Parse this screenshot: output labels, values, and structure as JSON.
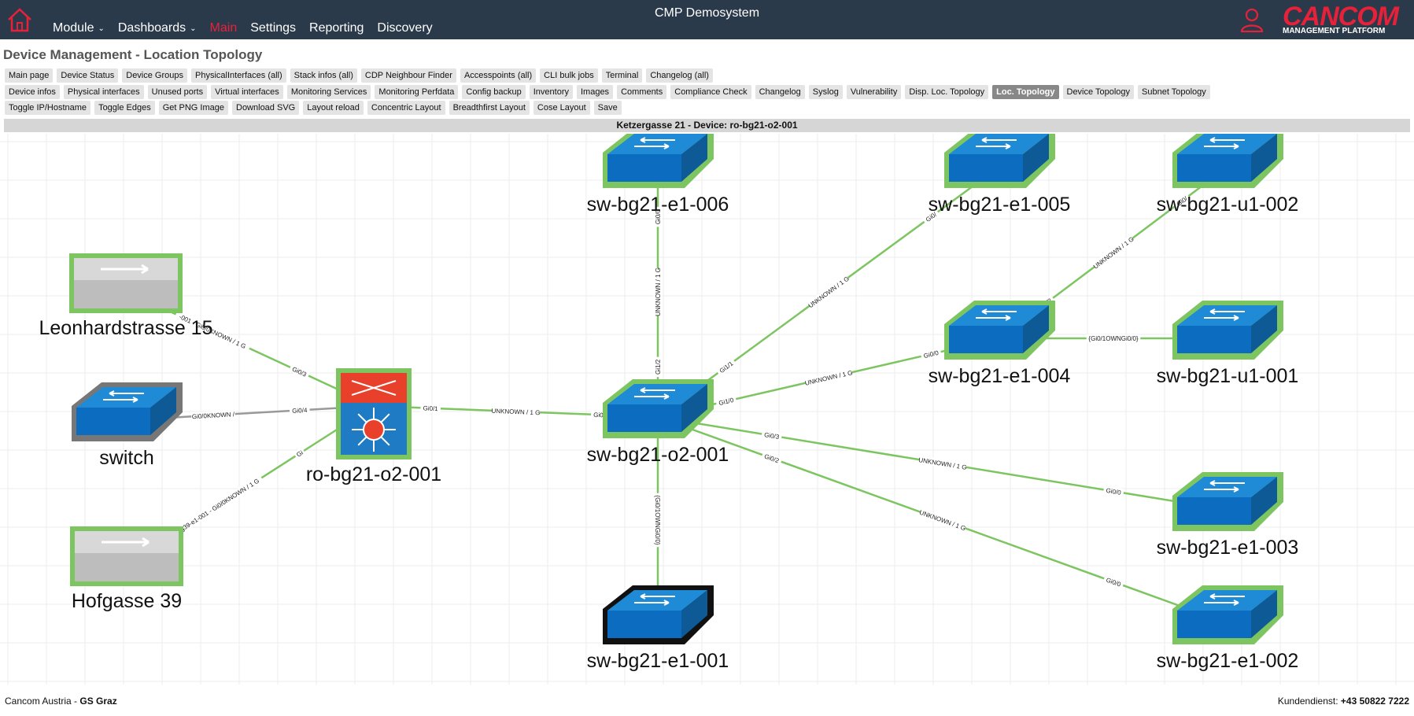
{
  "header": {
    "system_name": "CMP Demosystem",
    "nav": [
      {
        "label": "Module",
        "dropdown": true,
        "color": "#e8213a"
      },
      {
        "label": "Dashboards",
        "dropdown": true,
        "color": "#ffffff"
      },
      {
        "label": "Main",
        "dropdown": false,
        "color": "#e8213a"
      },
      {
        "label": "Settings",
        "dropdown": false,
        "color": "#ffffff"
      },
      {
        "label": "Reporting",
        "dropdown": false,
        "color": "#ffffff"
      },
      {
        "label": "Discovery",
        "dropdown": false,
        "color": "#ffffff"
      }
    ],
    "brand": "CANCOM",
    "brand_sub": "MANAGEMENT PLATFORM",
    "brand_color": "#e8213a",
    "bar_color": "#2b3a4a"
  },
  "page_title": "Device Management - Location Topology",
  "toolbar_rows": [
    [
      "Main page",
      "Device Status",
      "Device Groups",
      "PhysicalInterfaces (all)",
      "Stack infos (all)",
      "CDP Neighbour Finder",
      "Accesspoints (all)",
      "CLI bulk jobs",
      "Terminal",
      "Changelog (all)"
    ],
    [
      "Device infos",
      "Physical interfaces",
      "Unused ports",
      "Virtual interfaces",
      "Monitoring Services",
      "Monitoring Perfdata",
      "Config backup",
      "Inventory",
      "Images",
      "Comments",
      "Compliance Check",
      "Changelog",
      "Syslog",
      "Vulnerability",
      "Disp. Loc. Topology",
      "Loc. Topology",
      "Device Topology",
      "Subnet Topology"
    ],
    [
      "Toggle IP/Hostname",
      "Toggle Edges",
      "Get PNG Image",
      "Download SVG",
      "Layout reload",
      "Concentric Layout",
      "Breadthfirst Layout",
      "Cose Layout",
      "Save"
    ]
  ],
  "active_tab": "Loc. Topology",
  "device_header": "Ketzergasse 21 - Device: ro-bg21-o2-001",
  "topology": {
    "nodes": [
      {
        "id": "leon",
        "label": "Leonhardstrasse 15",
        "kind": "location",
        "border": "#7dc561"
      },
      {
        "id": "hof",
        "label": "Hofgasse 39",
        "kind": "location",
        "border": "#7dc561"
      },
      {
        "id": "switch",
        "label": "switch",
        "kind": "switch",
        "border": "#777777",
        "muted": true
      },
      {
        "id": "ro",
        "label": "ro-bg21-o2-001",
        "kind": "router",
        "border": "#7dc561",
        "selected": true
      },
      {
        "id": "o2",
        "label": "sw-bg21-o2-001",
        "kind": "switch",
        "border": "#7dc561"
      },
      {
        "id": "e6",
        "label": "sw-bg21-e1-006",
        "kind": "switch",
        "border": "#7dc561"
      },
      {
        "id": "e5",
        "label": "sw-bg21-e1-005",
        "kind": "switch",
        "border": "#7dc561"
      },
      {
        "id": "u2",
        "label": "sw-bg21-u1-002",
        "kind": "switch",
        "border": "#7dc561"
      },
      {
        "id": "e4",
        "label": "sw-bg21-e1-004",
        "kind": "switch",
        "border": "#7dc561"
      },
      {
        "id": "u1",
        "label": "sw-bg21-u1-001",
        "kind": "switch",
        "border": "#7dc561"
      },
      {
        "id": "e3",
        "label": "sw-bg21-e1-003",
        "kind": "switch",
        "border": "#7dc561"
      },
      {
        "id": "e2",
        "label": "sw-bg21-e1-002",
        "kind": "switch",
        "border": "#7dc561"
      },
      {
        "id": "e1",
        "label": "sw-bg21-e1-001",
        "kind": "switch",
        "border": "#111111"
      }
    ],
    "edges": [
      {
        "from": "leon",
        "to": "ro",
        "color": "#7dc561",
        "labels": [
          "-001 - Gi0/0KNOWN / 1 G",
          "Gi0/3"
        ]
      },
      {
        "from": "switch",
        "to": "ro",
        "color": "#999999",
        "labels": [
          "Gi0/0KNOWN /",
          "Gi0/4"
        ]
      },
      {
        "from": "hof",
        "to": "ro",
        "color": "#7dc561",
        "labels": [
          "sw-mg39-e1-001 - Gi0/0KNOWN / 1 G",
          "Gi"
        ]
      },
      {
        "from": "ro",
        "to": "o2",
        "color": "#7dc561",
        "labels": [
          "Gi0/1",
          "UNKNOWN / 1 G",
          "Gi0/0"
        ]
      },
      {
        "from": "o2",
        "to": "e6",
        "color": "#7dc561",
        "labels": [
          "Gi1/2",
          "UNKNOWN / 1 G",
          "Gi0/0"
        ]
      },
      {
        "from": "o2",
        "to": "e5",
        "color": "#7dc561",
        "labels": [
          "Gi1/1",
          "UNKNOWN / 1 G",
          "Gi0/"
        ]
      },
      {
        "from": "o2",
        "to": "e4",
        "color": "#7dc561",
        "labels": [
          "Gi1/0",
          "UNKNOWN / 1 G",
          "Gi0/0"
        ]
      },
      {
        "from": "e4",
        "to": "u2",
        "color": "#7dc561",
        "labels": [
          "Gi0/2",
          "UNKNOWN / 1 G",
          "Gi0/"
        ]
      },
      {
        "from": "e4",
        "to": "u1",
        "color": "#7dc561",
        "labels": [
          "{Gi0/1OWNGi0/0}"
        ]
      },
      {
        "from": "o2",
        "to": "e3",
        "color": "#7dc561",
        "labels": [
          "Gi0/3",
          "UNKNOWN / 1 G",
          "Gi0/0"
        ]
      },
      {
        "from": "o2",
        "to": "e2",
        "color": "#7dc561",
        "labels": [
          "Gi0/2",
          "UNKNOWN / 1 G",
          "Gi0/0"
        ]
      },
      {
        "from": "o2",
        "to": "e1",
        "color": "#7dc561",
        "labels": [
          "{Gi0/1OWNGi0/0}"
        ]
      }
    ]
  },
  "footer": {
    "left_prefix": "Cancom Austria - ",
    "left_strong": "GS Graz",
    "right_prefix": "Kundendienst: ",
    "right_strong": "+43 50822 7222"
  }
}
